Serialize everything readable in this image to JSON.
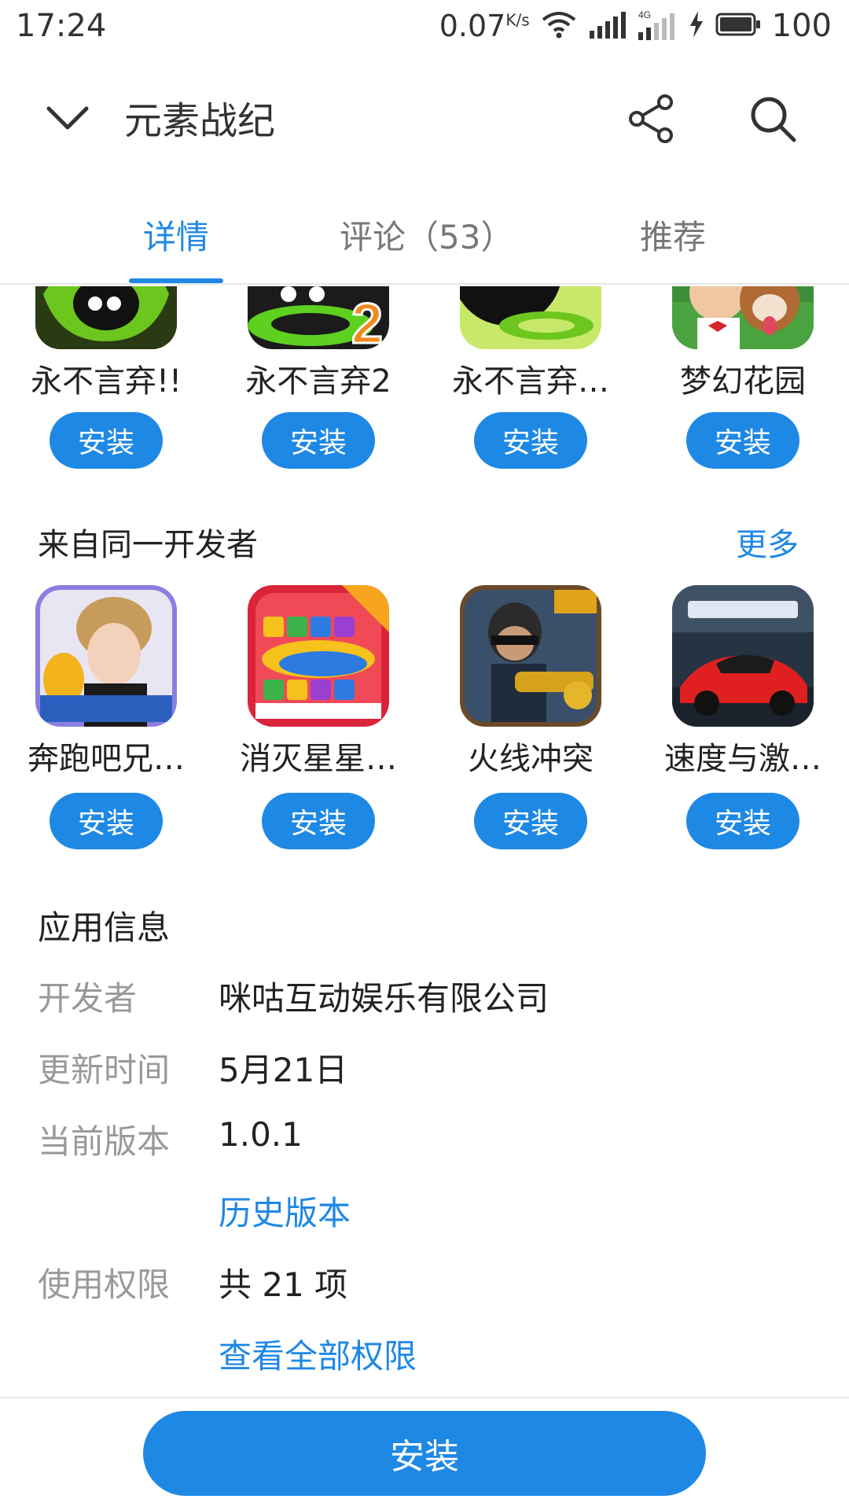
{
  "status_bar": {
    "time": "17:24",
    "speed": "0.07",
    "speed_unit": "K/s",
    "network": "4G",
    "battery": "100",
    "icons": [
      "wifi-icon",
      "signal-icon",
      "signal-4g-icon",
      "charging-icon",
      "battery-icon"
    ]
  },
  "header": {
    "title": "元素战纪",
    "icons": [
      "chevron-down-icon",
      "share-icon",
      "search-icon"
    ]
  },
  "tabs": [
    {
      "label": "详情",
      "active": true
    },
    {
      "label": "评论（53）",
      "active": false
    },
    {
      "label": "推荐",
      "active": false
    }
  ],
  "similar_apps": [
    {
      "name": "永不言弃!!",
      "install": "安装"
    },
    {
      "name": "永不言弃2",
      "install": "安装"
    },
    {
      "name": "永不言弃…",
      "install": "安装"
    },
    {
      "name": "梦幻花园",
      "install": "安装"
    }
  ],
  "developer_section": {
    "title": "来自同一开发者",
    "more": "更多",
    "apps": [
      {
        "name": "奔跑吧兄…",
        "install": "安装"
      },
      {
        "name": "消灭星星…",
        "install": "安装"
      },
      {
        "name": "火线冲突",
        "install": "安装"
      },
      {
        "name": "速度与激…",
        "install": "安装"
      }
    ]
  },
  "app_info": {
    "title": "应用信息",
    "developer_label": "开发者",
    "developer_value": "咪咕互动娱乐有限公司",
    "updated_label": "更新时间",
    "updated_value": "5月21日",
    "version_label": "当前版本",
    "version_value": "1.0.1",
    "history_link": "历史版本",
    "permissions_label": "使用权限",
    "permissions_value": "共 21 项",
    "permissions_link": "查看全部权限"
  },
  "bottom": {
    "install": "安装"
  },
  "colors": {
    "accent": "#1e88e5",
    "label_gray": "#999999"
  }
}
